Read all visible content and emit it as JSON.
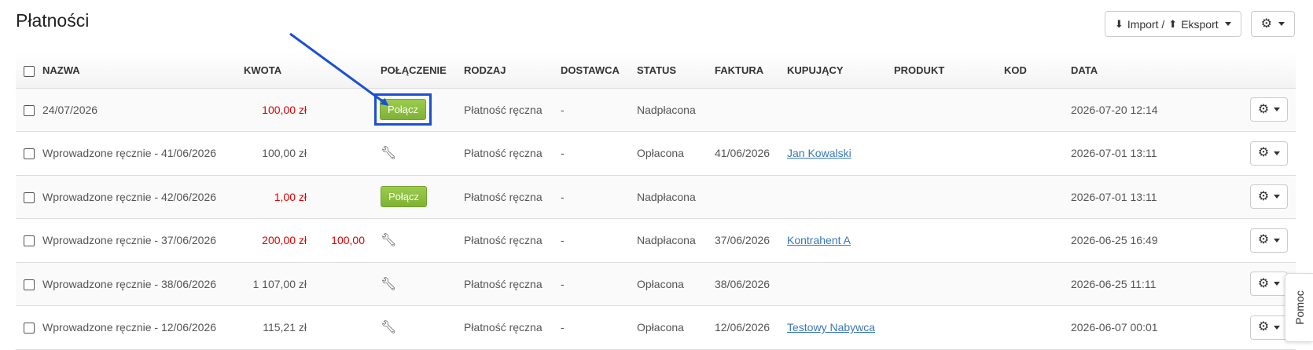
{
  "page": {
    "title": "Płatności",
    "import_export_label": "Import / ",
    "export_label": "Eksport",
    "help_tab": "Pomoc"
  },
  "icons": {
    "import": "circle-arrow-down-icon",
    "export": "circle-arrow-up-icon",
    "gear": "gear-icon",
    "wrench": "wrench-icon",
    "arrow": "blue-annotation-arrow"
  },
  "colors": {
    "negative_amount": "#e00000",
    "connect_button": "#8cc043",
    "annotation": "#1b4fd6",
    "link": "#3a77b9"
  },
  "table": {
    "columns": [
      "NAZWA",
      "KWOTA",
      "",
      "POŁĄCZENIE",
      "RODZAJ",
      "DOSTAWCA",
      "STATUS",
      "FAKTURA",
      "KUPUJĄCY",
      "PRODUKT",
      "KOD",
      "DATA",
      ""
    ],
    "rows": [
      {
        "name": "24/07/2026",
        "amount": "100,00 zł",
        "amount_red": true,
        "extra": "",
        "connection": "button",
        "connection_label": "Połącz",
        "highlighted": true,
        "type": "Płatność ręczna",
        "supplier": "-",
        "status": "Nadpłacona",
        "invoice": "",
        "buyer": "",
        "product": "",
        "code": "",
        "date": "2026-07-20 12:14"
      },
      {
        "name": "Wprowadzone ręcznie - 41/06/2026",
        "amount": "100,00 zł",
        "amount_red": false,
        "extra": "",
        "connection": "wrench",
        "connection_label": "",
        "highlighted": false,
        "type": "Płatność ręczna",
        "supplier": "-",
        "status": "Opłacona",
        "invoice": "41/06/2026",
        "buyer": "Jan Kowalski",
        "product": "",
        "code": "",
        "date": "2026-07-01 13:11"
      },
      {
        "name": "Wprowadzone ręcznie - 42/06/2026",
        "amount": "1,00 zł",
        "amount_red": true,
        "extra": "",
        "connection": "button",
        "connection_label": "Połącz",
        "highlighted": false,
        "type": "Płatność ręczna",
        "supplier": "-",
        "status": "Nadpłacona",
        "invoice": "",
        "buyer": "",
        "product": "",
        "code": "",
        "date": "2026-07-01 13:11"
      },
      {
        "name": "Wprowadzone ręcznie - 37/06/2026",
        "amount": "200,00 zł",
        "amount_red": true,
        "extra": "100,00",
        "connection": "wrench",
        "connection_label": "",
        "highlighted": false,
        "type": "Płatność ręczna",
        "supplier": "-",
        "status": "Nadpłacona",
        "invoice": "37/06/2026",
        "buyer": "Kontrahent A",
        "product": "",
        "code": "",
        "date": "2026-06-25 16:49"
      },
      {
        "name": "Wprowadzone ręcznie - 38/06/2026",
        "amount": "1 107,00 zł",
        "amount_red": false,
        "extra": "",
        "connection": "wrench",
        "connection_label": "",
        "highlighted": false,
        "type": "Płatność ręczna",
        "supplier": "-",
        "status": "Opłacona",
        "invoice": "38/06/2026",
        "buyer": "",
        "product": "",
        "code": "",
        "date": "2026-06-25 11:11"
      },
      {
        "name": "Wprowadzone ręcznie - 12/06/2026",
        "amount": "115,21 zł",
        "amount_red": false,
        "extra": "",
        "connection": "wrench",
        "connection_label": "",
        "highlighted": false,
        "type": "Płatność ręczna",
        "supplier": "-",
        "status": "Opłacona",
        "invoice": "12/06/2026",
        "buyer": "Testowy Nabywca",
        "product": "",
        "code": "",
        "date": "2026-06-07 00:01"
      }
    ]
  }
}
